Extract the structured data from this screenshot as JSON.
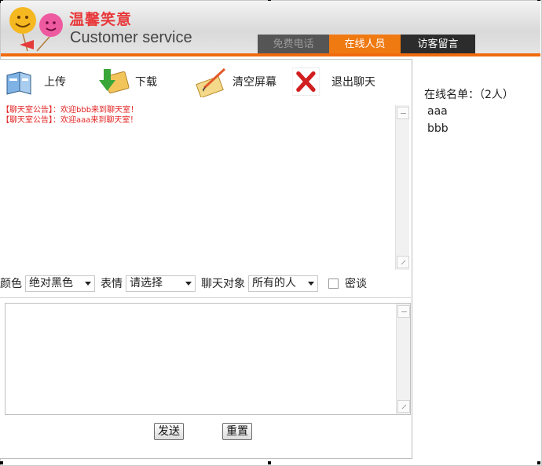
{
  "header": {
    "title_cn": "温馨笑意",
    "title_en": "Customer service",
    "tabs": [
      {
        "label": "免费电话"
      },
      {
        "label": "在线人员"
      },
      {
        "label": "访客留言"
      }
    ]
  },
  "toolbar": {
    "upload_label": "上传",
    "download_label": "下载",
    "clear_label": "清空屏幕",
    "exit_label": "退出聊天"
  },
  "messages": [
    {
      "text": "【聊天室公告】：欢迎bbb来到聊天室！"
    },
    {
      "text": "【聊天室公告】：欢迎aaa来到聊天室！"
    }
  ],
  "options": {
    "color_label": "颜色",
    "color_value": "绝对黑色",
    "emotion_label": "表情",
    "emotion_value": "请选择",
    "target_label": "聊天对象",
    "target_value": "所有的人",
    "secret_label": "密谈"
  },
  "buttons": {
    "send_label": "发送",
    "reset_label": "重置"
  },
  "online": {
    "title": "在线名单：（2人）",
    "users": [
      "aaa",
      "bbb"
    ]
  },
  "colors": {
    "accent": "#f06a0e",
    "announcement": "#e32525"
  }
}
